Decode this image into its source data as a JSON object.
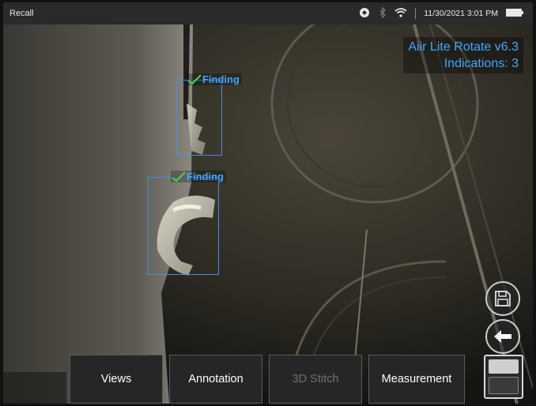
{
  "status_bar": {
    "app_name": "Recall",
    "datetime": "11/30/2021 3:01 PM",
    "icons": [
      "probe-icon",
      "bluetooth-icon",
      "wifi-icon",
      "battery-icon"
    ]
  },
  "overlay": {
    "title": "Aiir Lite Rotate v6.3",
    "indications": "Indications: 3"
  },
  "findings": [
    {
      "label": "Finding"
    },
    {
      "label": "Finding"
    }
  ],
  "toolbar": {
    "views_label": "Views",
    "annotation_label": "Annotation",
    "stitch_label": "3D Stitch",
    "measurement_label": "Measurement"
  },
  "colors": {
    "overlay_text": "#3fa7ff",
    "finding_box": "#3b8ff0",
    "check": "#4fd14a",
    "status_bar": "#2a2a2a"
  }
}
